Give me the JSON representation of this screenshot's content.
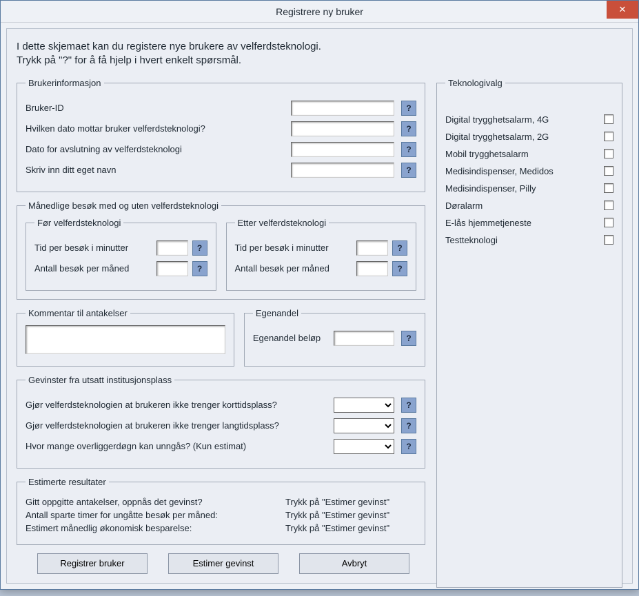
{
  "window": {
    "title": "Registrere ny bruker"
  },
  "intro": "I dette skjemaet kan du registere nye brukere av velferdsteknologi.\nTrykk på \"?\" for å få hjelp i hvert enkelt spørsmål.",
  "help_glyph": "?",
  "sections": {
    "user": {
      "legend": "Brukerinformasjon",
      "id_label": "Bruker-ID",
      "id_value": "",
      "recv_label": "Hvilken dato mottar bruker velferdsteknologi?",
      "recv_value": "",
      "end_label": "Dato for avslutning av velferdsteknologi",
      "end_value": "",
      "name_label": "Skriv inn ditt eget navn",
      "name_value": ""
    },
    "visits": {
      "legend": "Månedlige besøk med og uten velferdsteknologi",
      "before": {
        "legend": "Før velferdsteknologi",
        "time_label": "Tid per besøk i minutter",
        "time_value": "",
        "count_label": "Antall besøk per måned",
        "count_value": ""
      },
      "after": {
        "legend": "Etter velferdsteknologi",
        "time_label": "Tid per besøk i minutter",
        "time_value": "",
        "count_label": "Antall besøk per måned",
        "count_value": ""
      }
    },
    "comment": {
      "legend": "Kommentar til antakelser",
      "value": ""
    },
    "egen": {
      "legend": "Egenandel",
      "label": "Egenandel beløp",
      "value": ""
    },
    "gains": {
      "legend": "Gevinster fra utsatt institusjonsplass",
      "q1": "Gjør velferdsteknologien at brukeren ikke trenger korttidsplass?",
      "q1_value": "",
      "q2": "Gjør velferdsteknologien at brukeren ikke trenger langtidsplass?",
      "q2_value": "",
      "q3": "Hvor mange overliggerdøgn kan unngås? (Kun estimat)",
      "q3_value": ""
    },
    "est": {
      "legend": "Estimerte resultater",
      "r1_label": "Gitt oppgitte antakelser, oppnås det gevinst?",
      "r1_value": "Trykk på \"Estimer gevinst\"",
      "r2_label": "Antall sparte timer for ungåtte besøk per måned:",
      "r2_value": "Trykk på \"Estimer gevinst\"",
      "r3_label": "Estimert månedlig økonomisk besparelse:",
      "r3_value": "Trykk på \"Estimer gevinst\""
    },
    "tech": {
      "legend": "Teknologivalg",
      "items": [
        "Digital trygghetsalarm, 4G",
        "Digital trygghetsalarm, 2G",
        "Mobil trygghetsalarm",
        "Medisindispenser, Medidos",
        "Medisindispenser, Pilly",
        "Døralarm",
        "E-lås hjemmetjeneste",
        "Testteknologi"
      ]
    }
  },
  "buttons": {
    "register": "Registrer bruker",
    "estimate": "Estimer gevinst",
    "cancel": "Avbryt"
  }
}
